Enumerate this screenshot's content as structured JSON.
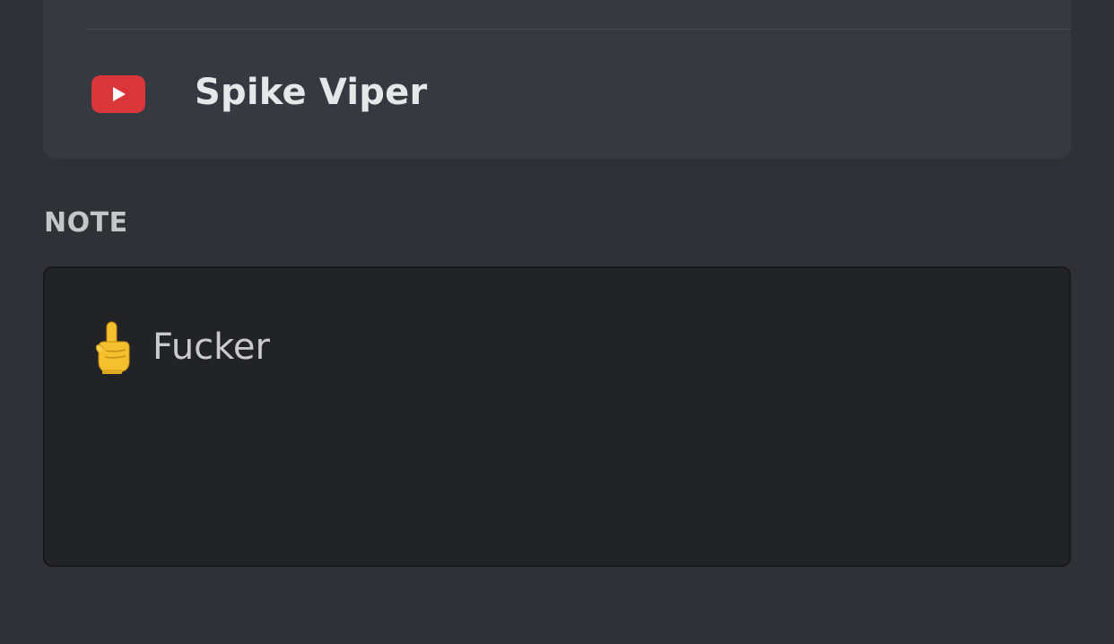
{
  "connections": {
    "items": [
      {
        "service_icon": "youtube-icon",
        "name": "Spike Viper",
        "brand_color": "#d9363a"
      }
    ]
  },
  "note": {
    "heading": "NOTE",
    "emoji_icon": "pointing-up-hand-icon",
    "text": "Fucker"
  },
  "colors": {
    "background": "#2f3136",
    "card": "#36393f",
    "note_box": "#222327",
    "text_primary": "#e6e7e9",
    "text_muted": "#c4c6ca"
  }
}
